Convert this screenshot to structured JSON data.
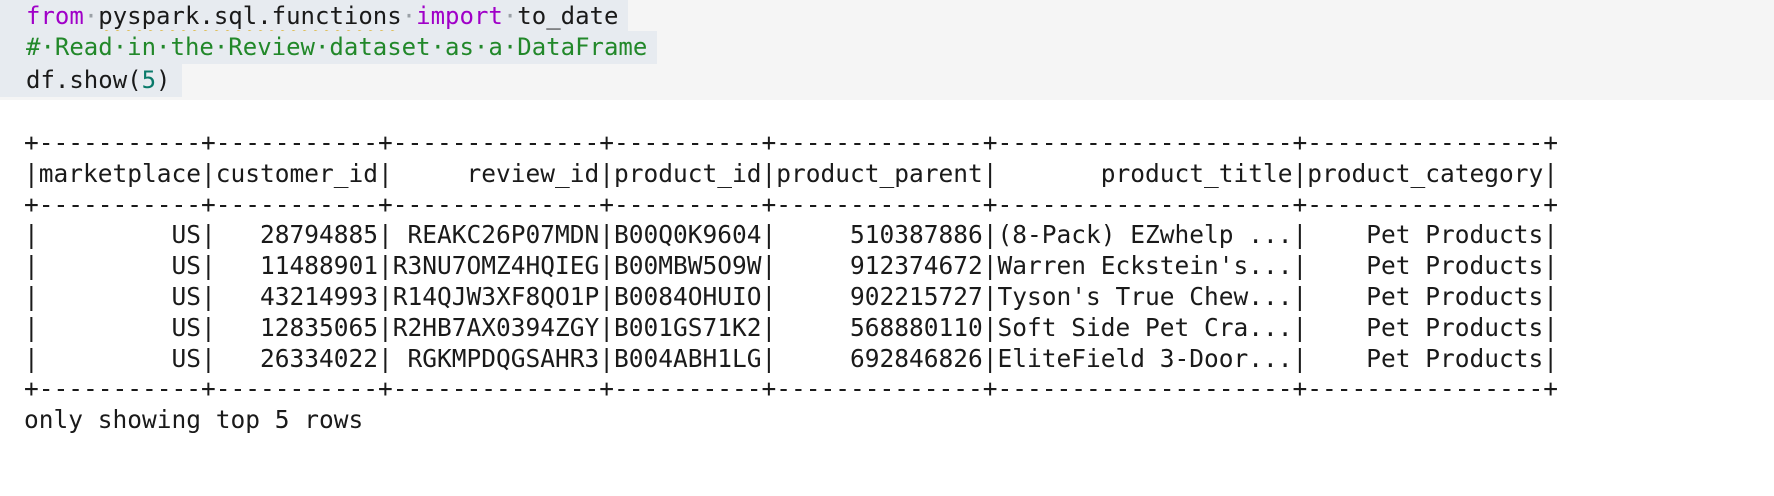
{
  "code": {
    "line1": {
      "kw_from": "from",
      "module": "pyspark.sql.functions",
      "kw_import": "import",
      "name": "to_date"
    },
    "line2": {
      "comment": "#·Read·in·the·Review·dataset·as·a·DataFrame"
    },
    "line3": {
      "call": "df.show(",
      "arg": "5",
      "close": ")"
    }
  },
  "output": {
    "border": "+-----------+-----------+--------------+----------+--------------+--------------------+----------------+",
    "header": "|marketplace|customer_id|     review_id|product_id|product_parent|       product_title|product_category|",
    "rows": [
      "|         US|   28794885| REAKC26P07MDN|B00Q0K9604|     510387886|(8-Pack) EZwhelp ...|    Pet Products|",
      "|         US|   11488901|R3NU7OMZ4HQIEG|B00MBW5O9W|     912374672|Warren Eckstein's...|    Pet Products|",
      "|         US|   43214993|R14QJW3XF8QO1P|B0084OHUIO|     902215727|Tyson's True Chew...|    Pet Products|",
      "|         US|   12835065|R2HB7AX0394ZGY|B001GS71K2|     568880110|Soft Side Pet Cra...|    Pet Products|",
      "|         US|   26334022| RGKMPDQGSAHR3|B004ABH1LG|     692846826|EliteField 3-Door...|    Pet Products|"
    ],
    "footer": "only showing top 5 rows"
  }
}
